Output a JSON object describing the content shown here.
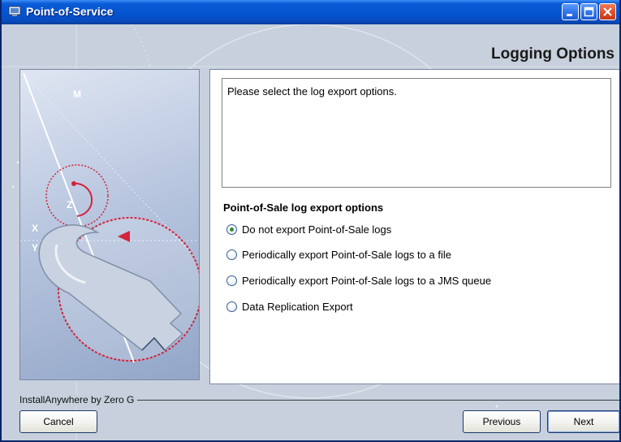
{
  "window": {
    "title": "Point-of-Service",
    "controls": {
      "minimize": "minimize-icon",
      "maximize": "maximize-icon",
      "close": "close-icon"
    }
  },
  "header": {
    "title": "Logging Options"
  },
  "main": {
    "description": "Please select the log export options.",
    "section_label": "Point-of-Sale log export options",
    "options": [
      {
        "label": "Do not export Point-of-Sale logs",
        "selected": true
      },
      {
        "label": "Periodically export Point-of-Sale logs to a file",
        "selected": false
      },
      {
        "label": "Periodically export Point-of-Sale logs to a JMS queue",
        "selected": false
      },
      {
        "label": "Data Replication Export",
        "selected": false
      }
    ]
  },
  "left_image": {
    "labels": {
      "m": "M",
      "z": "Z",
      "x": "X",
      "y": "Y"
    },
    "icon": "wrench-icon"
  },
  "footer": {
    "installer_label": "InstallAnywhere by Zero G",
    "cancel_label": "Cancel",
    "previous_label": "Previous",
    "next_label": "Next"
  },
  "colors": {
    "titlebar": "#0453d0",
    "window_bg": "#c7d0dc",
    "accent_red": "#d4233a",
    "radio_dot": "#2e8b3a"
  }
}
